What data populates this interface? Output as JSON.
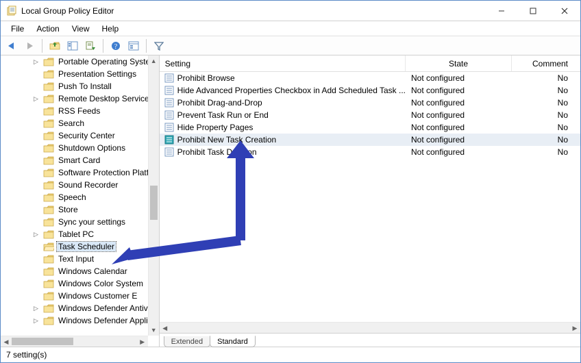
{
  "window": {
    "title": "Local Group Policy Editor"
  },
  "menu": {
    "items": [
      "File",
      "Action",
      "View",
      "Help"
    ]
  },
  "toolbar": {
    "icons": [
      "back-icon",
      "forward-icon",
      "up-icon",
      "show-hide-tree-icon",
      "export-icon",
      "refresh-icon",
      "help-icon",
      "properties-icon",
      "filter-icon"
    ]
  },
  "tree": {
    "items": [
      {
        "label": "Portable Operating Syste",
        "expandable": true
      },
      {
        "label": "Presentation Settings"
      },
      {
        "label": "Push To Install"
      },
      {
        "label": "Remote Desktop Services",
        "expandable": true
      },
      {
        "label": "RSS Feeds"
      },
      {
        "label": "Search"
      },
      {
        "label": "Security Center"
      },
      {
        "label": "Shutdown Options"
      },
      {
        "label": "Smart Card"
      },
      {
        "label": "Software Protection Platf"
      },
      {
        "label": "Sound Recorder"
      },
      {
        "label": "Speech"
      },
      {
        "label": "Store"
      },
      {
        "label": "Sync your settings"
      },
      {
        "label": "Tablet PC",
        "expandable": true
      },
      {
        "label": "Task Scheduler",
        "selected": true,
        "open": true
      },
      {
        "label": "Text Input"
      },
      {
        "label": "Windows Calendar"
      },
      {
        "label": "Windows Color System"
      },
      {
        "label": "Windows Customer E"
      },
      {
        "label": "Windows Defender Antiv",
        "expandable": true
      },
      {
        "label": "Windows Defender Appli",
        "expandable": true
      }
    ]
  },
  "list": {
    "columns": {
      "setting": "Setting",
      "state": "State",
      "comment": "Comment"
    },
    "rows": [
      {
        "name": "Prohibit Browse",
        "state": "Not configured",
        "comment": "No"
      },
      {
        "name": "Hide Advanced Properties Checkbox in Add Scheduled Task ...",
        "state": "Not configured",
        "comment": "No"
      },
      {
        "name": "Prohibit Drag-and-Drop",
        "state": "Not configured",
        "comment": "No"
      },
      {
        "name": "Prevent Task Run or End",
        "state": "Not configured",
        "comment": "No"
      },
      {
        "name": "Hide Property Pages",
        "state": "Not configured",
        "comment": "No"
      },
      {
        "name": "Prohibit New Task Creation",
        "state": "Not configured",
        "comment": "No",
        "selected": true
      },
      {
        "name": "Prohibit Task Deletion",
        "state": "Not configured",
        "comment": "No"
      }
    ],
    "tabs": {
      "extended": "Extended",
      "standard": "Standard",
      "active": "standard"
    }
  },
  "statusbar": {
    "text": "7 setting(s)"
  }
}
